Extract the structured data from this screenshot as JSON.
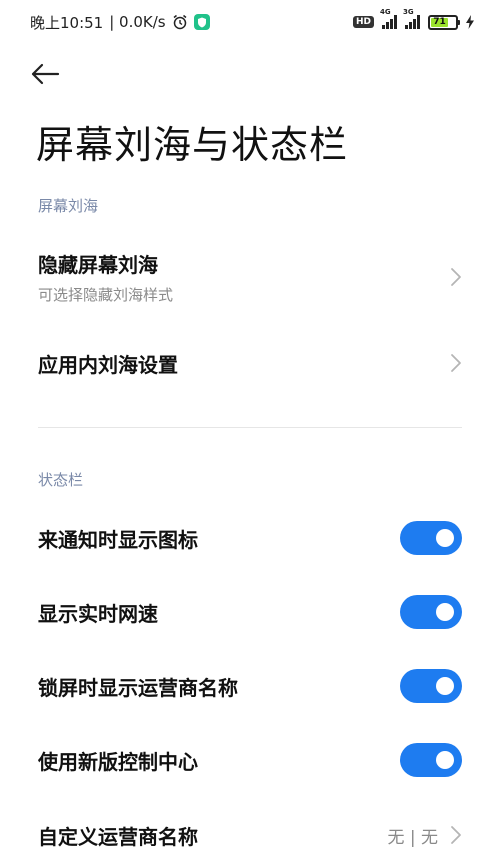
{
  "status_bar": {
    "time": "晚上10:51",
    "speed": "| 0.0K/s",
    "net1": "4G",
    "net2": "3G",
    "hd": "HD",
    "battery": "71",
    "battery_level": 0.71
  },
  "page": {
    "title": "屏幕刘海与状态栏"
  },
  "notch_section": {
    "header": "屏幕刘海",
    "items": [
      {
        "title": "隐藏屏幕刘海",
        "subtitle": "可选择隐藏刘海样式"
      },
      {
        "title": "应用内刘海设置"
      }
    ]
  },
  "status_section": {
    "header": "状态栏",
    "toggles": [
      {
        "title": "来通知时显示图标",
        "on": true
      },
      {
        "title": "显示实时网速",
        "on": true
      },
      {
        "title": "锁屏时显示运营商名称",
        "on": true
      },
      {
        "title": "使用新版控制中心",
        "on": true
      }
    ],
    "carrier": {
      "title": "自定义运营商名称",
      "value": "无 | 无"
    }
  },
  "colors": {
    "accent": "#1e7cf0",
    "section_header": "#7a89a8",
    "battery_fill": "#9be22d"
  }
}
